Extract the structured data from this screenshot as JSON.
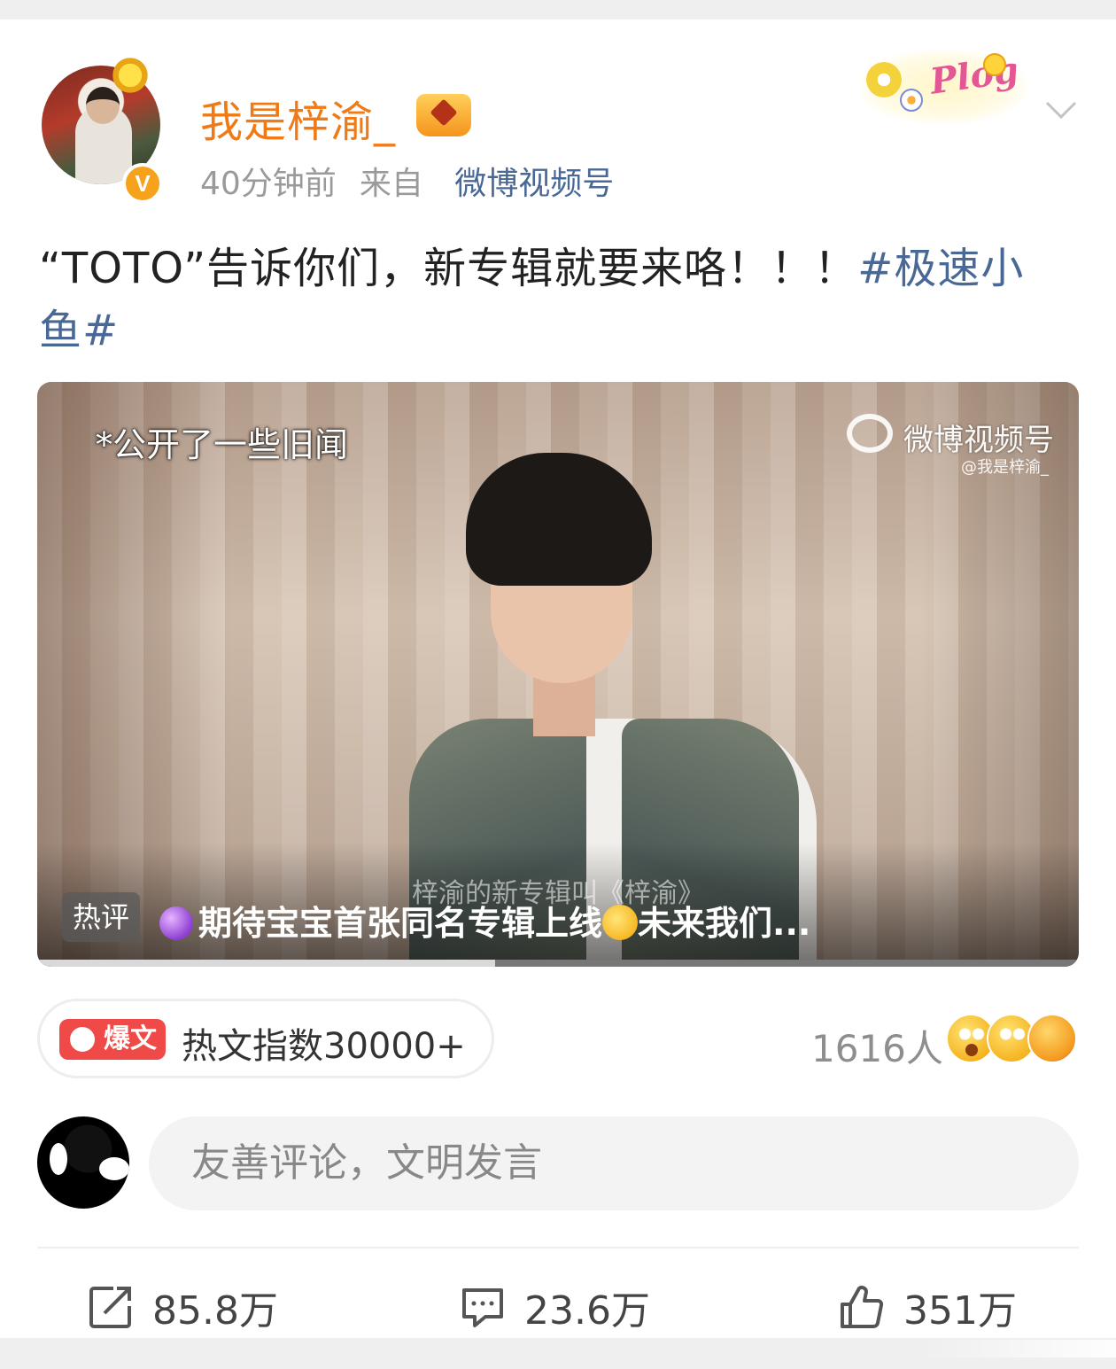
{
  "post": {
    "username": "我是梓渝_",
    "time": "40分钟前",
    "from_label": "来自",
    "source": "微博视频号",
    "text": "“TOTO”告诉你们，新专辑就要来咯！！！",
    "hashtag": "#极速小鱼#",
    "plog_sticker": "Plog"
  },
  "video": {
    "overlay_text": "*公开了一些旧闻",
    "watermark_name": "微博视频号",
    "watermark_handle": "@我是梓渝_",
    "caption": "梓渝的新专辑叫《梓渝》",
    "hot_badge": "热评",
    "hot_comment": "期待宝宝首张同名专辑上线",
    "hot_comment_tail": "未来我们...",
    "progress": 0.44
  },
  "stats": {
    "boom_label": "爆文",
    "hot_index": "热文指数30000+",
    "reactions_count": "1616人"
  },
  "comment_box": {
    "placeholder": "友善评论，文明发言"
  },
  "actions": {
    "reposts": "85.8万",
    "comments": "23.6万",
    "likes": "351万"
  },
  "icons": [
    "verified-v-icon",
    "crown-badge-icon",
    "chevron-down-icon",
    "weibo-logo-icon",
    "repost-icon",
    "comment-icon",
    "like-icon"
  ],
  "colors": {
    "username": "#f07a16",
    "link": "#4a6896",
    "boom": "#ef4a47"
  }
}
